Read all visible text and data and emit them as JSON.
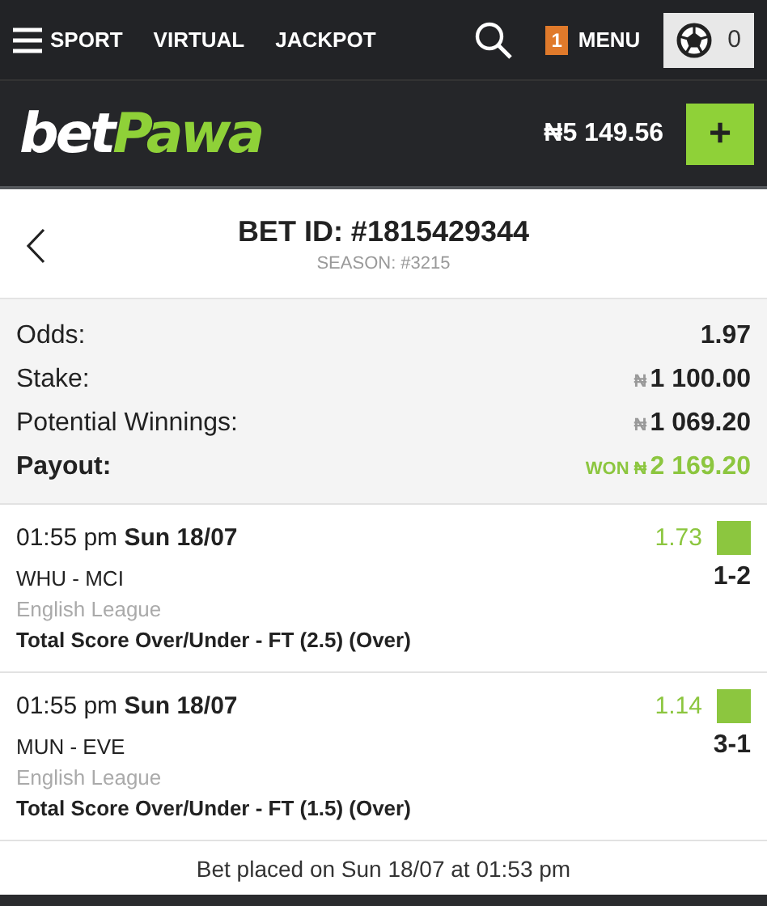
{
  "top_nav": {
    "items": [
      {
        "label": "SPORT"
      },
      {
        "label": "VIRTUAL"
      },
      {
        "label": "JACKPOT"
      }
    ],
    "menu": {
      "badge": "1",
      "label": "MENU"
    },
    "betslip": {
      "count": "0"
    }
  },
  "account_bar": {
    "logo": [
      "bet",
      "Pawa"
    ],
    "balance": "₦5 149.56",
    "deposit": "+"
  },
  "header": {
    "title": "BET ID: #1815429344",
    "subtitle": "SEASON: #3215"
  },
  "summary": [
    {
      "kind": "plain",
      "label": "Odds:",
      "value": "1.97"
    },
    {
      "kind": "money",
      "label": "Stake:",
      "currency": "₦",
      "value": "1 100.00"
    },
    {
      "kind": "money",
      "label": "Potential Winnings:",
      "currency": "₦",
      "value": "1 069.20"
    },
    {
      "kind": "payout",
      "label": "Payout:",
      "status": "WON",
      "currency": "₦",
      "value": "2 169.20"
    }
  ],
  "bets": [
    {
      "time": "01:55 pm",
      "date": "Sun 18/07",
      "odds": "1.73",
      "color": "#8cc63f",
      "teams": "WHU - MCI",
      "score": "1-2",
      "league": "English League",
      "market": "Total Score Over/Under - FT (2.5) (Over)"
    },
    {
      "time": "01:55 pm",
      "date": "Sun 18/07",
      "odds": "1.14",
      "color": "#8cc63f",
      "teams": "MUN - EVE",
      "score": "3-1",
      "league": "English League",
      "market": "Total Score Over/Under - FT (1.5) (Over)"
    }
  ],
  "footer": "Bet placed on Sun 18/07 at 01:53 pm"
}
